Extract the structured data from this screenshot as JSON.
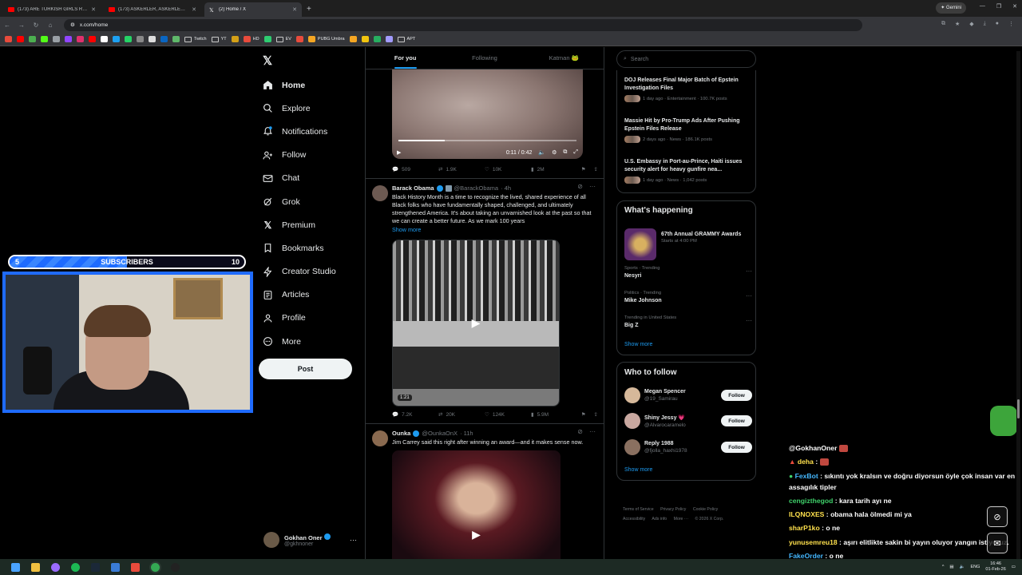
{
  "browser": {
    "tabs": [
      {
        "title": "(173) ARE TURKISH GIRLS REAL...",
        "icon": "youtube-icon",
        "active": false
      },
      {
        "title": "(173) ASKERLER, ASKERLERIN K...",
        "icon": "youtube-icon",
        "active": false
      },
      {
        "title": "(2) Home / X",
        "icon": "x-icon",
        "active": true
      }
    ],
    "gemini_label": "Gemini",
    "url": "x.com/home",
    "bookmarks": [
      "Twitch",
      "YT",
      "HD",
      "EV",
      "PUBG Umbra",
      "APT"
    ]
  },
  "nav": {
    "items": [
      {
        "label": "Home",
        "icon": "home-icon"
      },
      {
        "label": "Explore",
        "icon": "search-icon"
      },
      {
        "label": "Notifications",
        "icon": "bell-icon"
      },
      {
        "label": "Follow",
        "icon": "person-add-icon"
      },
      {
        "label": "Chat",
        "icon": "mail-icon"
      },
      {
        "label": "Grok",
        "icon": "grok-icon"
      },
      {
        "label": "Premium",
        "icon": "x-icon"
      },
      {
        "label": "Bookmarks",
        "icon": "bookmark-icon"
      },
      {
        "label": "Creator Studio",
        "icon": "bolt-icon"
      },
      {
        "label": "Articles",
        "icon": "article-icon"
      },
      {
        "label": "Profile",
        "icon": "person-icon"
      },
      {
        "label": "More",
        "icon": "more-circle-icon"
      }
    ],
    "post_label": "Post",
    "user": {
      "name": "Gokhan Oner",
      "handle": "@gkhnoner"
    }
  },
  "feed": {
    "tabs": [
      "For you",
      "Following",
      "Katman 🐸"
    ],
    "video1": {
      "time": "0:11 / 0:42",
      "progress": 0.26
    },
    "video1_stats": {
      "replies": "509",
      "reposts": "1.9K",
      "likes": "10K",
      "views": "2M"
    },
    "post1": {
      "name": "Barack Obama",
      "handle": "@BarackObama",
      "time": "· 4h",
      "text": "Black History Month is a time to recognize the lived, shared experience of all Black folks who have fundamentally shaped, challenged, and ultimately strengthened America. It's about taking an unvarnished look at the past so that we can create a better future. As we mark 100 years",
      "show_more": "Show more",
      "duration": "1:21",
      "stats": {
        "replies": "7.2K",
        "reposts": "20K",
        "likes": "124K",
        "views": "5.9M"
      }
    },
    "post2": {
      "name": "Ounka",
      "handle": "@OunkaOnX",
      "time": "· 11h",
      "text": "Jim Carrey said this right after winning an award—and it makes sense now."
    }
  },
  "right": {
    "search_placeholder": "Search",
    "news": [
      {
        "title": "DOJ Releases Final Major Batch of Epstein Investigation Files",
        "meta": "1 day ago · Entertainment · 100.7K posts"
      },
      {
        "title": "Massie Hit by Pro-Trump Ads After Pushing Epstein Files Release",
        "meta": "2 days ago · News · 186.1K posts"
      },
      {
        "title": "U.S. Embassy in Port-au-Prince, Haiti issues security alert for heavy gunfire nea...",
        "meta": "1 day ago · News · 1,042 posts"
      }
    ],
    "happening": {
      "title": "What's happening",
      "event": {
        "title": "67th Annual GRAMMY Awards",
        "sub": "Starts at 4:00 PM"
      },
      "trends": [
        {
          "context": "Sports · Trending",
          "name": "Nesyri"
        },
        {
          "context": "Politics · Trending",
          "name": "Mike Johnson"
        },
        {
          "context": "Trending in United States",
          "name": "Big Z"
        }
      ],
      "show_more": "Show more"
    },
    "who_to_follow": {
      "title": "Who to follow",
      "people": [
        {
          "name": "Megan Spencer",
          "handle": "@19_Samirau"
        },
        {
          "name": "Shiny Jessy 💗",
          "handle": "@Alvarocaramelo"
        },
        {
          "name": "Reply 1988",
          "handle": "@fjolla_haxhi1978"
        }
      ],
      "follow_label": "Follow",
      "show_more": "Show more"
    },
    "footer": [
      "Terms of Service",
      "Privacy Policy",
      "Cookie Policy",
      "Accessibility",
      "Ads info",
      "More ···",
      "© 2026 X Corp."
    ]
  },
  "stream": {
    "sub_goal": {
      "label": "SUBSCRIBERS",
      "current": "5",
      "goal": "10",
      "fraction": 0.5
    },
    "chat": [
      {
        "user": "@GokhanOner",
        "text": ""
      },
      {
        "user": "deha",
        "text": ""
      },
      {
        "user": "FexBot",
        "text": "sıkıntı yok kralsın ve doğru diyorsun öyle çok insan var en assagılık tipler"
      },
      {
        "user": "cengizthegod",
        "text": "kara tarih ayı ne"
      },
      {
        "user": "ILQNOXES",
        "text": "obama hala ölmedi mi ya"
      },
      {
        "user": "sharP1ko",
        "text": "o ne"
      },
      {
        "user": "yunusemreu18",
        "text": "aşırı elitlikte sakin bi yayın oluyor yangın istiyoruz."
      },
      {
        "user": "FakeOrder",
        "text": "o ne"
      }
    ]
  },
  "taskbar": {
    "lang": "ENG",
    "time": "16:46",
    "date": "01-Feb-26"
  },
  "colors": {
    "accent": "#1d9bf0",
    "background": "#000000",
    "border": "#2f3336",
    "stream_blue": "#1f6bff"
  }
}
